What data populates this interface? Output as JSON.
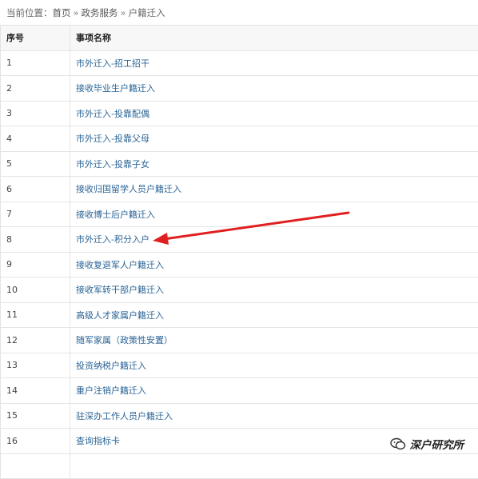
{
  "breadcrumb": {
    "prefix": "当前位置：",
    "items": [
      "首页",
      "政务服务",
      "户籍迁入"
    ],
    "separator": "»"
  },
  "table": {
    "headers": [
      "序号",
      "事项名称"
    ],
    "rows": [
      {
        "num": "1",
        "name": "市外迁入-招工招干"
      },
      {
        "num": "2",
        "name": "接收毕业生户籍迁入"
      },
      {
        "num": "3",
        "name": "市外迁入-投靠配偶"
      },
      {
        "num": "4",
        "name": "市外迁入-投靠父母"
      },
      {
        "num": "5",
        "name": "市外迁入-投靠子女"
      },
      {
        "num": "6",
        "name": "接收归国留学人员户籍迁入"
      },
      {
        "num": "7",
        "name": "接收博士后户籍迁入"
      },
      {
        "num": "8",
        "name": "市外迁入-积分入户"
      },
      {
        "num": "9",
        "name": "接收复退军人户籍迁入"
      },
      {
        "num": "10",
        "name": "接收军转干部户籍迁入"
      },
      {
        "num": "11",
        "name": "高级人才家属户籍迁入"
      },
      {
        "num": "12",
        "name": "随军家属（政策性安置）"
      },
      {
        "num": "13",
        "name": "投资纳税户籍迁入"
      },
      {
        "num": "14",
        "name": "重户注销户籍迁入"
      },
      {
        "num": "15",
        "name": "驻深办工作人员户籍迁入"
      },
      {
        "num": "16",
        "name": "查询指标卡"
      },
      {
        "num": "",
        "name": ""
      }
    ]
  },
  "annotation": {
    "arrow_color": "#e02020",
    "points_to": "市外迁入-积分入户"
  },
  "watermark": {
    "text": "深户研究所",
    "icon": "wechat-icon"
  },
  "colors": {
    "link": "#2a6496",
    "header_bg": "#f7f7f7",
    "border": "#e4e4e4"
  }
}
